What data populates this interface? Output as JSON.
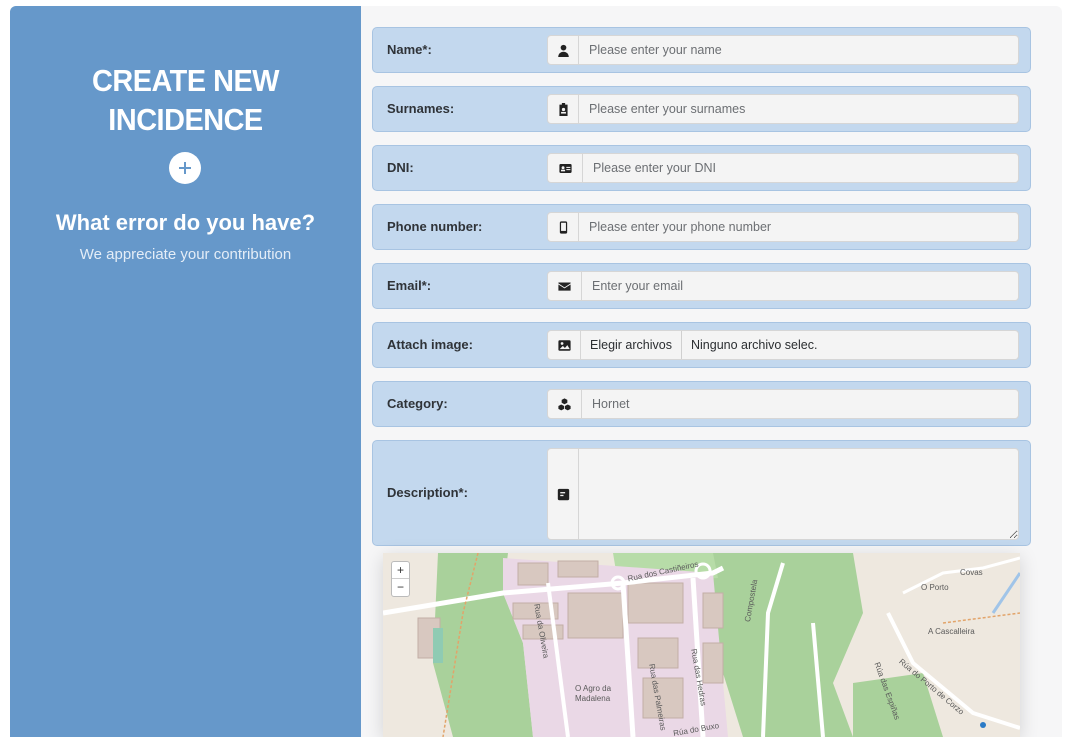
{
  "left": {
    "title_line1": "CREATE NEW",
    "title_line2": "INCIDENCE",
    "question": "What error do you have?",
    "subtitle": "We appreciate your contribution"
  },
  "form": {
    "name": {
      "label": "Name*:",
      "placeholder": "Please enter your name",
      "icon": "user-icon"
    },
    "surnames": {
      "label": "Surnames:",
      "placeholder": "Please enter your surnames",
      "icon": "id-badge-icon"
    },
    "dni": {
      "label": "DNI:",
      "placeholder": "Please enter your DNI",
      "icon": "id-card-icon"
    },
    "phone": {
      "label": "Phone number:",
      "placeholder": "Please enter your phone number",
      "icon": "mobile-icon"
    },
    "email": {
      "label": "Email*:",
      "placeholder": "Enter your email",
      "icon": "envelope-icon"
    },
    "image": {
      "label": "Attach image:",
      "button": "Elegir archivos",
      "status": "Ninguno archivo selec.",
      "icon": "image-icon"
    },
    "category": {
      "label": "Category:",
      "value": "Hornet",
      "icon": "cubes-icon"
    },
    "description": {
      "label": "Description*:",
      "value": "",
      "icon": "comment-icon"
    }
  },
  "map": {
    "zoom_in": "+",
    "zoom_out": "−",
    "labels": {
      "rua_castineiros": "Rua dos Castiñeiros",
      "rua_oliveira": "Rua da Oliveira",
      "rua_hedras": "Rua das Hedras",
      "rua_palmeiras": "Rua das Palmeiras",
      "agro_madalena_1": "O Agro da",
      "agro_madalena_2": "Madalena",
      "covas": "Covas",
      "porto": "O Porto",
      "cascalleira": "A Cascalleira",
      "rua_porto_corzo": "Rúa do Porto de Corzo",
      "rua_espinas": "Rúa das Espiñas",
      "rua_buxo": "Rúa do Buxo",
      "compostela": "Compostela"
    }
  }
}
